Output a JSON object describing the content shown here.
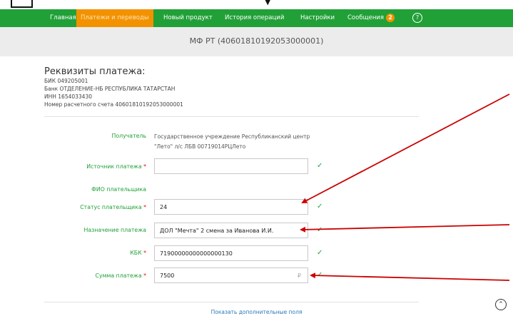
{
  "nav": {
    "items": [
      {
        "label": "Главная",
        "active": false
      },
      {
        "label": "Платежи и переводы",
        "active": true
      },
      {
        "label": "Новый продукт",
        "active": false
      },
      {
        "label": "История операций",
        "active": false
      },
      {
        "label": "Настройки",
        "active": false
      },
      {
        "label": "Сообщения",
        "active": false
      }
    ],
    "messages_count": "2",
    "help_icon": "?"
  },
  "account": {
    "title": "МФ РТ (40601810192053000001)"
  },
  "requisites": {
    "heading": "Реквизиты платежа:",
    "lines": [
      "БИК  049205001",
      "Банк  ОТДЕЛЕНИЕ-НБ РЕСПУБЛИКА ТАТАРСТАН",
      "ИНН  1654033430",
      "Номер расчетного счета  40601810192053000001"
    ]
  },
  "form": {
    "recipient_label": "Получатель",
    "recipient_value": "Государственное учреждение Республиканский центр \"Лето\" л/с ЛБВ 00719014РЦЛето",
    "source_label": "Источник платежа",
    "source_value": "",
    "fio_label": "ФИО плательщика",
    "status_label": "Статус плательщика",
    "status_value": "24",
    "purpose_label": "Назначение платежа",
    "purpose_value": "ДОЛ \"Мечта\" 2 смена за Иванова И.И.",
    "kbk_label": "КБК",
    "kbk_value": "71900000000000000130",
    "amount_label": "Сумма платежа",
    "amount_value": "7500",
    "currency": "₽",
    "required_mark": "*"
  },
  "footer": {
    "show_more": "Показать дополнительные поля"
  },
  "colors": {
    "brand_green": "#21a038",
    "active_orange": "#f39200",
    "annotation_red": "#cc0000"
  },
  "icons": [
    "check-icon",
    "help-icon",
    "scroll-up-icon",
    "arrow-annotation"
  ]
}
